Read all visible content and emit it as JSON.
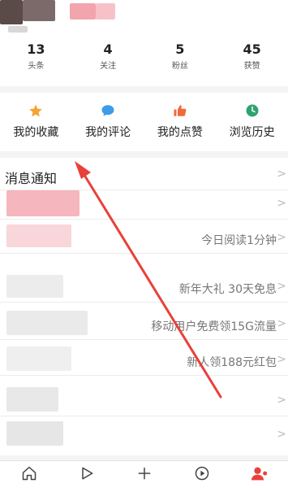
{
  "stats": [
    {
      "value": "13",
      "label": "头条"
    },
    {
      "value": "4",
      "label": "关注"
    },
    {
      "value": "5",
      "label": "粉丝"
    },
    {
      "value": "45",
      "label": "获赞"
    }
  ],
  "shortcuts": [
    {
      "label": "我的收藏",
      "icon": "star-icon",
      "color": "#f4a533"
    },
    {
      "label": "我的评论",
      "icon": "comment-icon",
      "color": "#3d9be9"
    },
    {
      "label": "我的点赞",
      "icon": "thumbs-up-icon",
      "color": "#f06a3a"
    },
    {
      "label": "浏览历史",
      "icon": "clock-icon",
      "color": "#2fa36f"
    }
  ],
  "menu": {
    "notifications_title": "消息通知",
    "reading_text": "今日阅读1分钟",
    "new_year_text": "新年大礼 30天免息",
    "mobile_text": "移动用户免费领15G流量",
    "red_packet_text": "新人领188元红包",
    "chevron": ">"
  },
  "colors": {
    "annotation_arrow": "#e8413a",
    "accent_red": "#e8413a"
  },
  "bottom_nav": [
    {
      "icon": "home-icon"
    },
    {
      "icon": "play-icon"
    },
    {
      "icon": "plus-icon"
    },
    {
      "icon": "video-icon"
    },
    {
      "icon": "profile-icon"
    }
  ]
}
